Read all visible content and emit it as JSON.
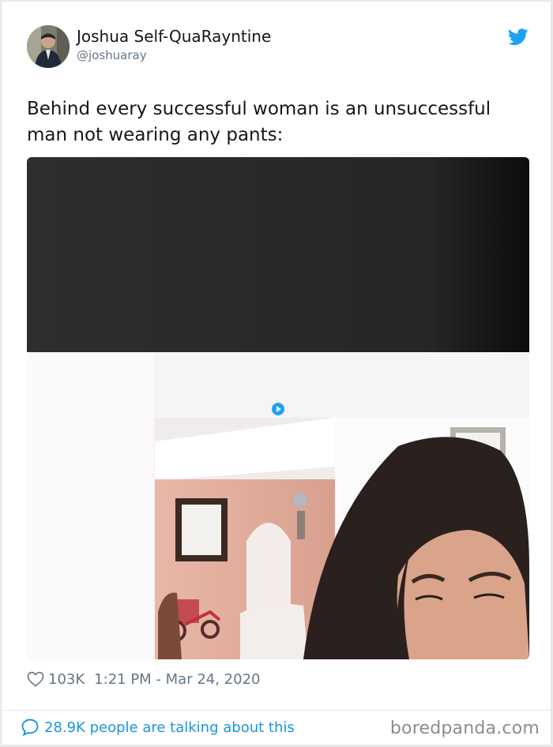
{
  "author": {
    "name": "Joshua Self-QuaRayntine",
    "handle": "@joshuaray",
    "avatar_icon": "avatar-photo"
  },
  "tweet": {
    "text": "Behind every successful woman is an unsuccessful man not wearing any pants:"
  },
  "media": {
    "kind": "video-still",
    "play_icon": "play-icon"
  },
  "meta": {
    "likes": "103K",
    "timestamp": "1:21 PM - Mar 24, 2020",
    "heart_icon": "heart-outline-icon"
  },
  "footer": {
    "talking_label": "28.9K people are talking about this",
    "bubble_icon": "speech-bubble-icon",
    "watermark": "boredpanda.com"
  },
  "colors": {
    "twitter_blue": "#1da1f2",
    "link_blue": "#1b95e0",
    "text_primary": "#14171a",
    "text_secondary": "#657786",
    "watermark": "#8c8c8c"
  }
}
